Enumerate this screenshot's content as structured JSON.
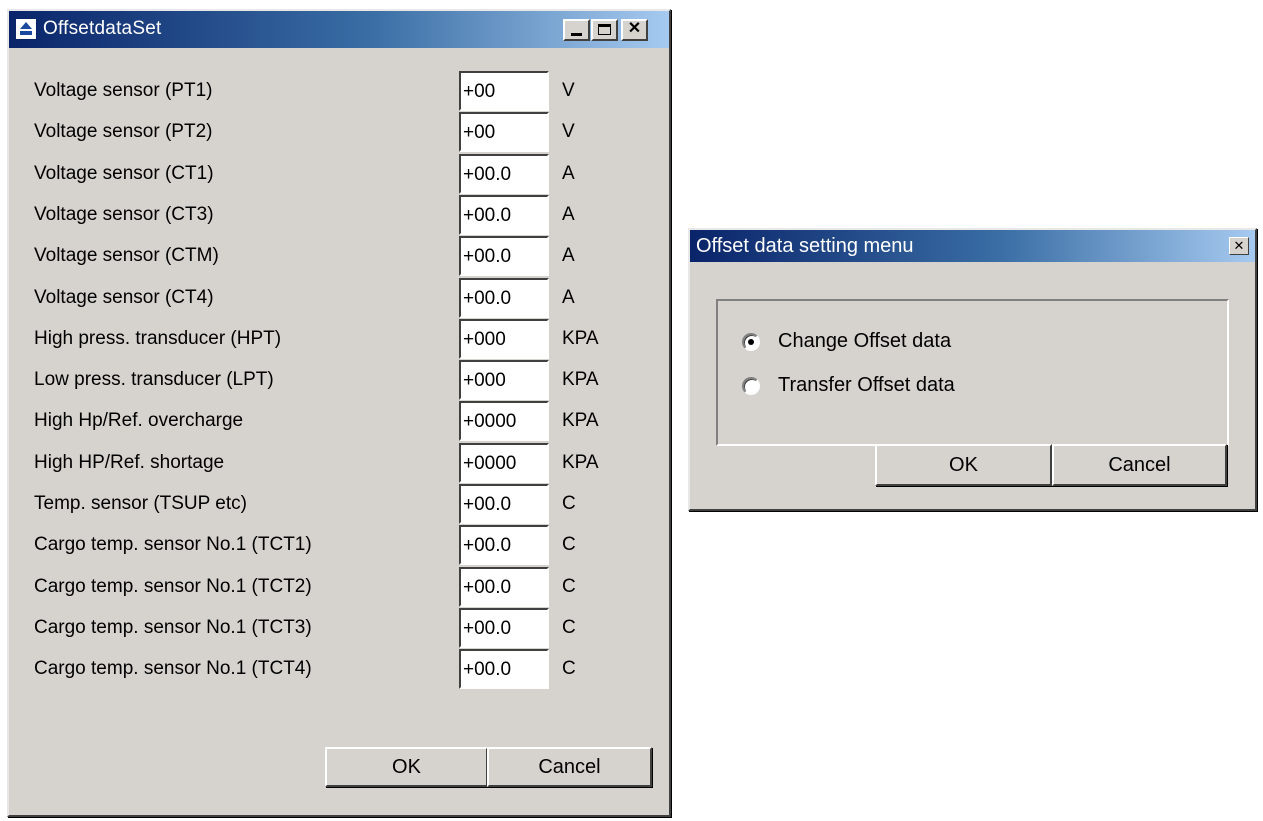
{
  "offset_window": {
    "title": "OffsetdataSet",
    "title_buttons": {
      "minimize": "",
      "maximize": "",
      "close": "✕"
    },
    "rows": [
      {
        "label": "Voltage sensor (PT1)",
        "value": "+00",
        "unit": "V"
      },
      {
        "label": "Voltage sensor (PT2)",
        "value": "+00",
        "unit": "V"
      },
      {
        "label": "Voltage sensor (CT1)",
        "value": "+00.0",
        "unit": "A"
      },
      {
        "label": "Voltage sensor (CT3)",
        "value": "+00.0",
        "unit": "A"
      },
      {
        "label": "Voltage sensor (CTM)",
        "value": "+00.0",
        "unit": "A"
      },
      {
        "label": "Voltage sensor (CT4)",
        "value": "+00.0",
        "unit": "A"
      },
      {
        "label": "High press. transducer (HPT)",
        "value": "+000",
        "unit": "KPA"
      },
      {
        "label": "Low press. transducer (LPT)",
        "value": "+000",
        "unit": "KPA"
      },
      {
        "label": "High Hp/Ref. overcharge",
        "value": "+0000",
        "unit": "KPA"
      },
      {
        "label": "High HP/Ref. shortage",
        "value": "+0000",
        "unit": "KPA"
      },
      {
        "label": "Temp. sensor (TSUP etc)",
        "value": "+00.0",
        "unit": "C"
      },
      {
        "label": "Cargo temp. sensor No.1 (TCT1)",
        "value": "+00.0",
        "unit": "C"
      },
      {
        "label": "Cargo temp. sensor No.1 (TCT2)",
        "value": "+00.0",
        "unit": "C"
      },
      {
        "label": "Cargo temp. sensor No.1 (TCT3)",
        "value": "+00.0",
        "unit": "C"
      },
      {
        "label": "Cargo temp. sensor No.1 (TCT4)",
        "value": "+00.0",
        "unit": "C"
      }
    ],
    "ok_label": "OK",
    "cancel_label": "Cancel"
  },
  "menu_dialog": {
    "title": "Offset data setting menu",
    "close": "✕",
    "options": [
      {
        "label": "Change Offset data",
        "selected": true
      },
      {
        "label": "Transfer Offset data",
        "selected": false
      }
    ],
    "ok_label": "OK",
    "cancel_label": "Cancel"
  },
  "colors": {
    "title_gradient_start": "#0a246a",
    "title_gradient_end": "#a6caf0",
    "face": "#d6d3ce"
  }
}
